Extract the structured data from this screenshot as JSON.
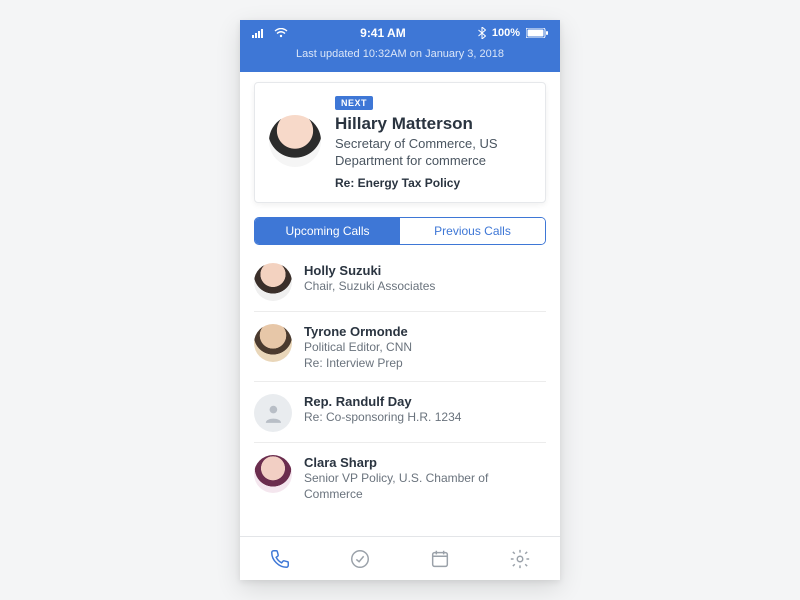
{
  "statusbar": {
    "time": "9:41 AM",
    "battery": "100%"
  },
  "header": {
    "last_updated": "Last updated 10:32AM on January 3, 2018"
  },
  "next": {
    "badge": "NEXT",
    "name": "Hillary Matterson",
    "title": "Secretary of Commerce, US Department for commerce",
    "subject": "Re: Energy Tax Policy"
  },
  "tabs": {
    "upcoming": "Upcoming Calls",
    "previous": "Previous Calls"
  },
  "calls": [
    {
      "name": "Holly Suzuki",
      "sub": "Chair, Suzuki Associates",
      "re": ""
    },
    {
      "name": "Tyrone Ormonde",
      "sub": "Political Editor, CNN",
      "re": "Re: Interview Prep"
    },
    {
      "name": "Rep. Randulf Day",
      "sub": "",
      "re": "Re: Co-sponsoring H.R. 1234"
    },
    {
      "name": "Clara Sharp",
      "sub": "Senior VP Policy, U.S. Chamber of Commerce",
      "re": ""
    }
  ]
}
